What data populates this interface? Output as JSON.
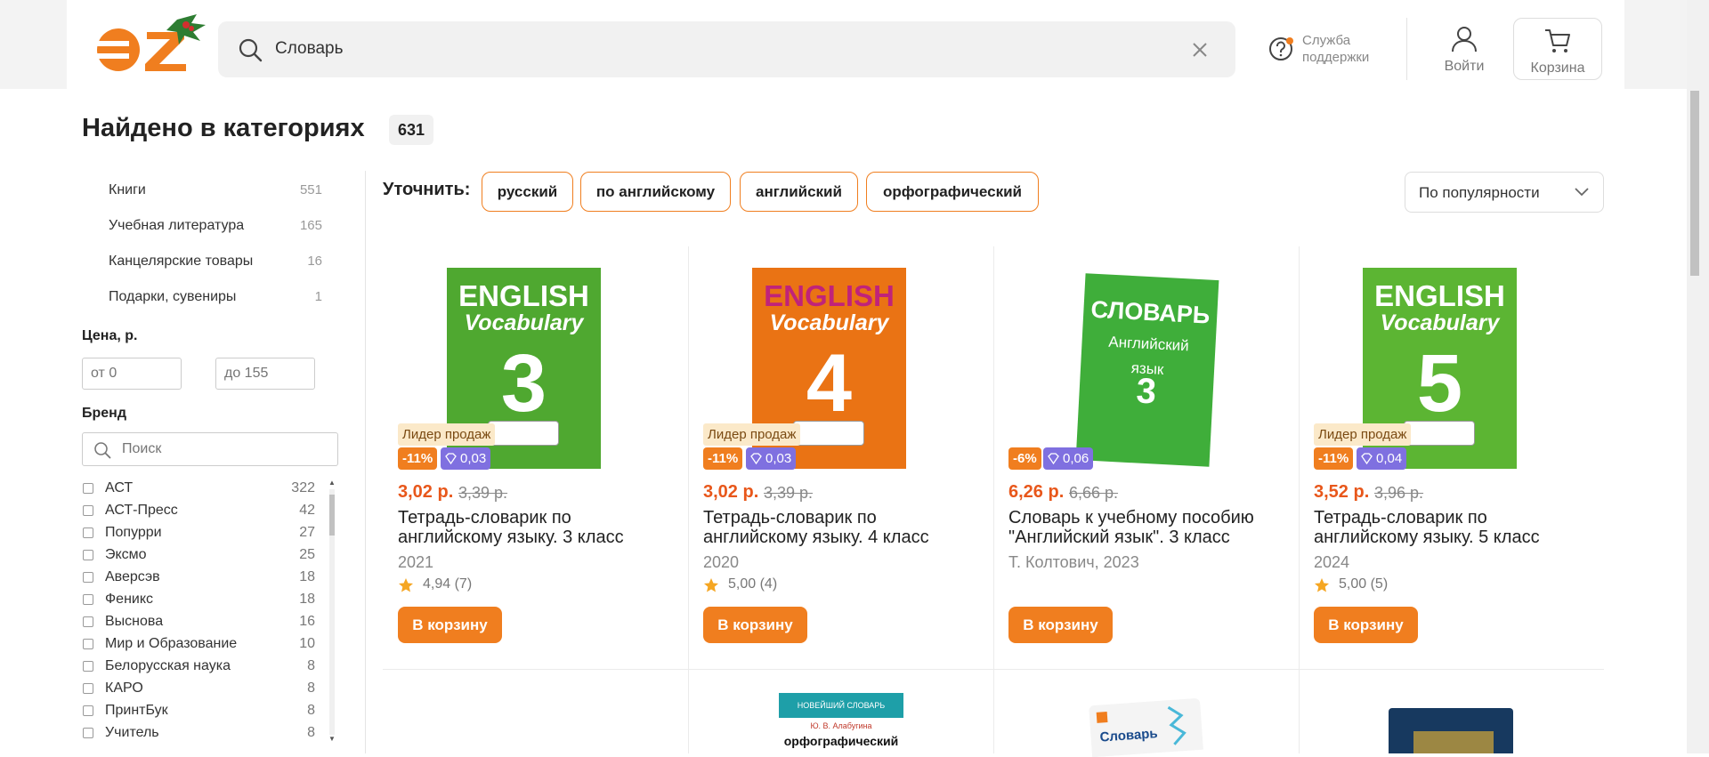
{
  "header": {
    "logo_text": "OZ",
    "search": {
      "value": "Словарь",
      "placeholder": ""
    },
    "support_label": "Служба поддержки",
    "login_label": "Войти",
    "cart_label": "Корзина"
  },
  "page": {
    "title": "Найдено в категориях",
    "count": "631"
  },
  "sidebar": {
    "categories": [
      {
        "label": "Книги",
        "count": "551"
      },
      {
        "label": "Учебная литература",
        "count": "165"
      },
      {
        "label": "Канцелярские товары",
        "count": "16"
      },
      {
        "label": "Подарки, сувениры",
        "count": "1"
      }
    ],
    "price": {
      "heading": "Цена, р.",
      "from_placeholder": "от 0",
      "to_placeholder": "до 155"
    },
    "brand": {
      "heading": "Бренд",
      "search_placeholder": "Поиск",
      "items": [
        {
          "label": "АСТ",
          "count": "322"
        },
        {
          "label": "АСТ-Пресс",
          "count": "42"
        },
        {
          "label": "Попурри",
          "count": "27"
        },
        {
          "label": "Эксмо",
          "count": "25"
        },
        {
          "label": "Аверсэв",
          "count": "18"
        },
        {
          "label": "Феникс",
          "count": "18"
        },
        {
          "label": "Выснова",
          "count": "16"
        },
        {
          "label": "Мир и Образование",
          "count": "10"
        },
        {
          "label": "Белорусская наука",
          "count": "8"
        },
        {
          "label": "КАРО",
          "count": "8"
        },
        {
          "label": "ПринтБук",
          "count": "8"
        },
        {
          "label": "Учитель",
          "count": "8"
        }
      ]
    }
  },
  "refine": {
    "label": "Уточнить:",
    "chips": [
      "русский",
      "по английскому",
      "английский",
      "орфографический"
    ]
  },
  "sort": {
    "selected": "По популярности"
  },
  "products": [
    {
      "cover": {
        "line1": "ENGLISH",
        "line2": "Vocabulary",
        "number": "3",
        "color": "#4fa830"
      },
      "leader_badge": "Лидер продаж",
      "discount": "-11%",
      "cashback": "0,03",
      "price": "3,02 р.",
      "old_price": "3,39 р.",
      "title": "Тетрадь-словарик по английскому языку. 3 класс",
      "meta": "2021",
      "rating": "4,94 (7)",
      "button": "В корзину"
    },
    {
      "cover": {
        "line1": "ENGLISH",
        "line2": "Vocabulary",
        "number": "4",
        "color": "#ea7314"
      },
      "leader_badge": "Лидер продаж",
      "discount": "-11%",
      "cashback": "0,03",
      "price": "3,02 р.",
      "old_price": "3,39 р.",
      "title": "Тетрадь-словарик по английскому языку. 4 класс",
      "meta": "2020",
      "rating": "5,00 (4)",
      "button": "В корзину"
    },
    {
      "cover": {
        "line1": "СЛОВАРЬ",
        "line2": "Английский язык",
        "number": "3",
        "color": "#3fae3a"
      },
      "leader_badge": "",
      "discount": "-6%",
      "cashback": "0,06",
      "price": "6,26 р.",
      "old_price": "6,66 р.",
      "title": "Словарь к учебному пособию \"Английский язык\". 3 класс",
      "meta": "Т. Колтович, 2023",
      "rating": "",
      "button": "В корзину"
    },
    {
      "cover": {
        "line1": "ENGLISH",
        "line2": "Vocabulary",
        "number": "5",
        "color": "#5cb533"
      },
      "leader_badge": "Лидер продаж",
      "discount": "-11%",
      "cashback": "0,04",
      "price": "3,52 р.",
      "old_price": "3,96 р.",
      "title": "Тетрадь-словарик по английскому языку. 5 класс",
      "meta": "2024",
      "rating": "5,00 (5)",
      "button": "В корзину"
    }
  ],
  "next_row_peek": {
    "cover2_top": "НОВЕЙШИЙ СЛОВАРЬ",
    "cover2_author": "Ю. В. Алабугина",
    "cover2_title": "орфографический",
    "cover3_title": "Словарь"
  },
  "colors": {
    "accent": "#f07e1f",
    "price": "#e8571b",
    "cashback": "#7f70e0",
    "leader_badge_bg": "#fbe9c9"
  }
}
